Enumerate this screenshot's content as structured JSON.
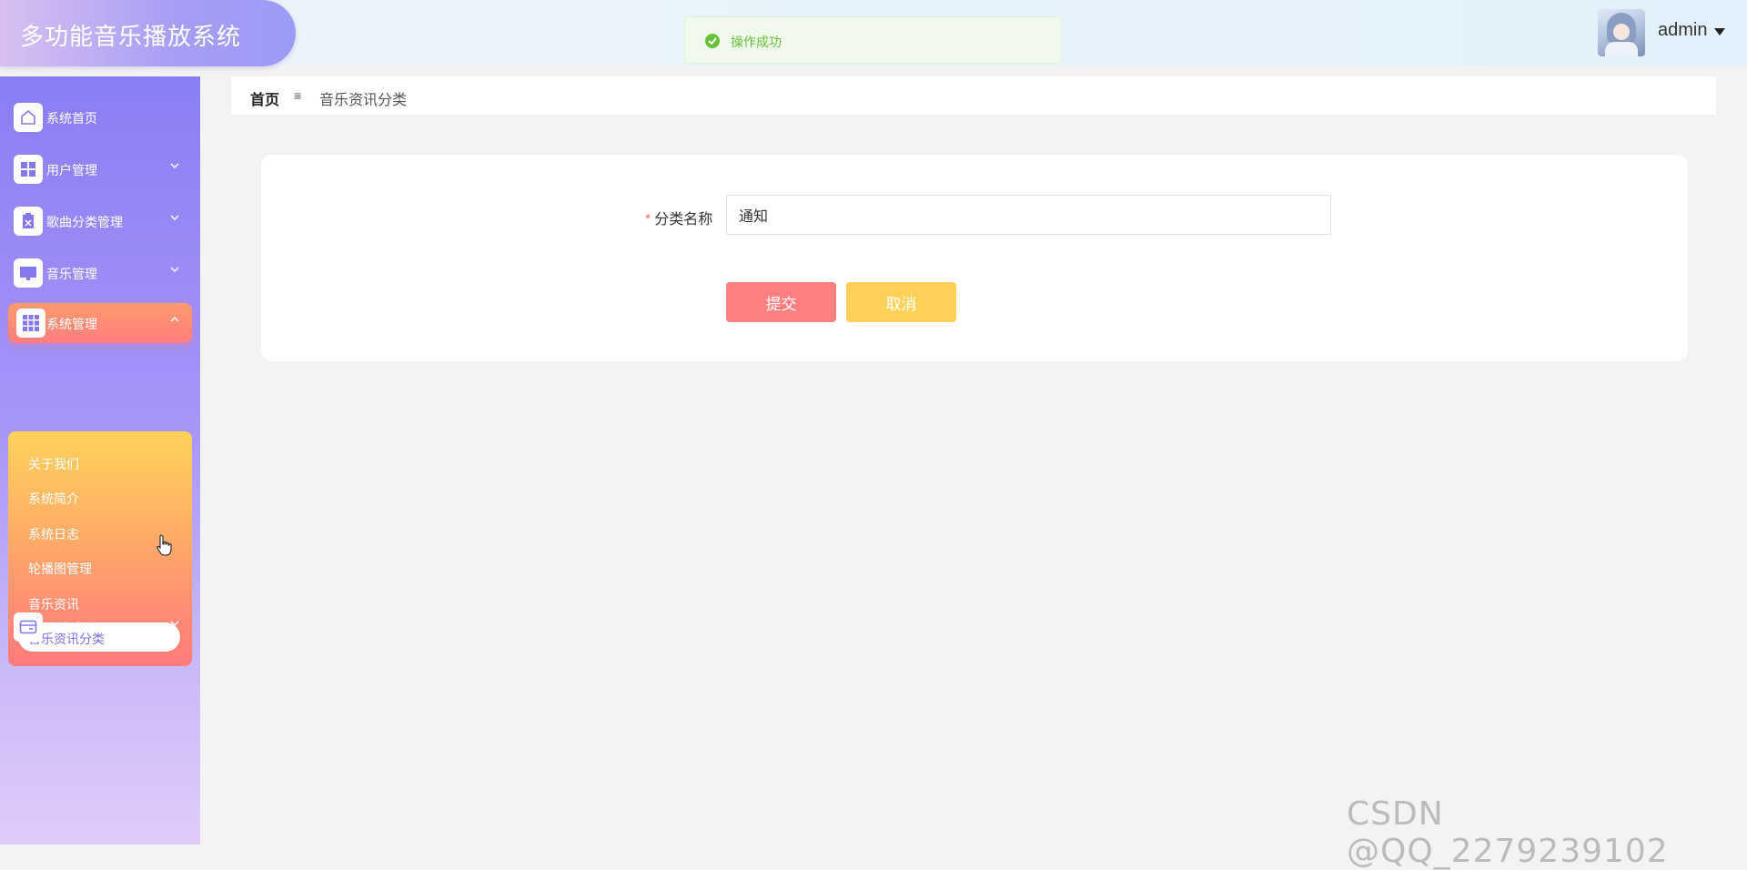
{
  "header": {
    "app_title": "多功能音乐播放系统",
    "toast_message": "操作成功",
    "username": "admin"
  },
  "sidebar": {
    "items": [
      {
        "label": "系统首页",
        "icon": "home-icon"
      },
      {
        "label": "用户管理",
        "icon": "grid-icon"
      },
      {
        "label": "歌曲分类管理",
        "icon": "clipboard-icon"
      },
      {
        "label": "音乐管理",
        "icon": "monitor-icon"
      },
      {
        "label": "系统管理",
        "icon": "apps-icon",
        "expanded": true
      },
      {
        "label": "个人中心",
        "icon": "card-icon"
      }
    ],
    "submenu": [
      {
        "label": "关于我们"
      },
      {
        "label": "系统简介"
      },
      {
        "label": "系统日志"
      },
      {
        "label": "轮播图管理"
      },
      {
        "label": "音乐资讯"
      },
      {
        "label": "音乐资讯分类",
        "selected": true
      }
    ]
  },
  "breadcrumb": {
    "home": "首页",
    "separator": "≡",
    "current": "音乐资讯分类"
  },
  "form": {
    "field_label": "分类名称",
    "required_mark": "*",
    "field_value": "通知",
    "submit_label": "提交",
    "cancel_label": "取消"
  },
  "watermark": "CSDN @QQ_2279239102",
  "colors": {
    "submit": "#ff8080",
    "cancel": "#ffd157",
    "success": "#67c23a",
    "sidebar_active": "#ff8e73"
  }
}
